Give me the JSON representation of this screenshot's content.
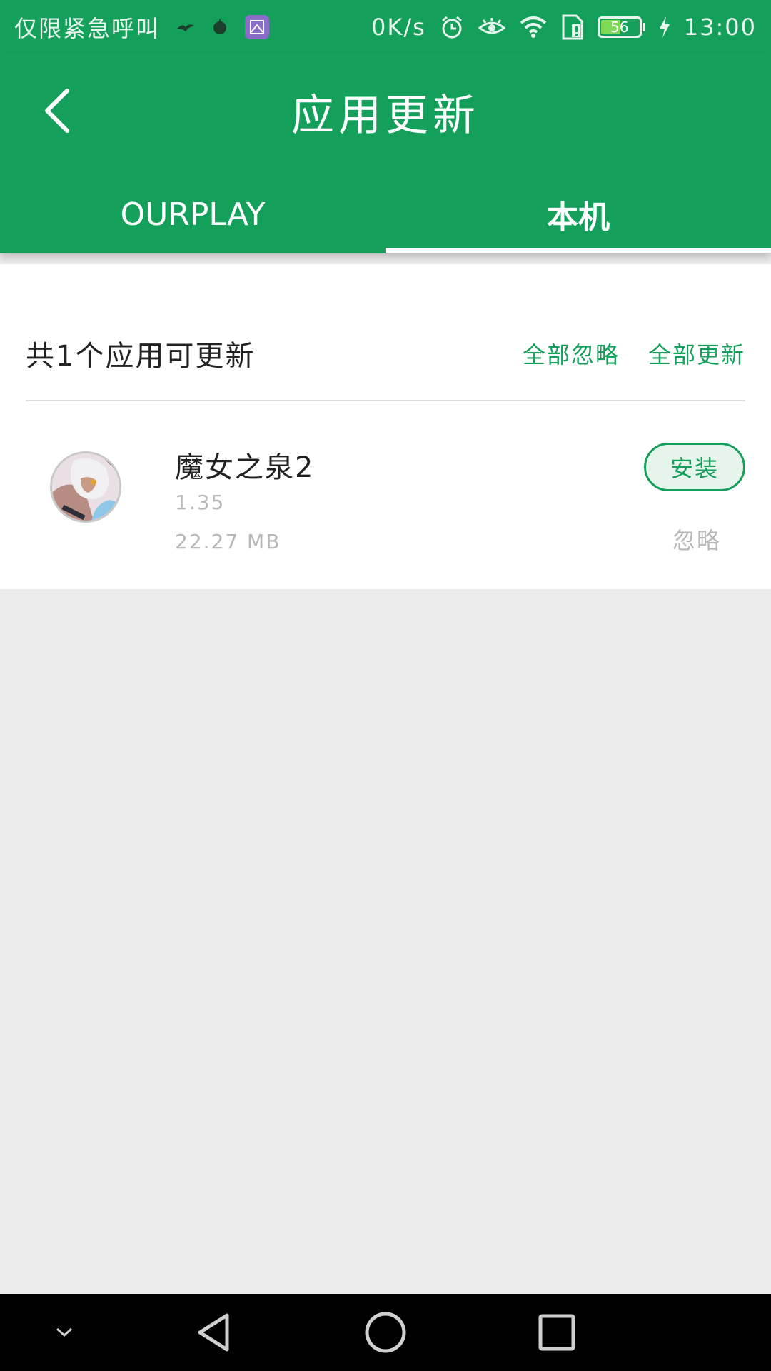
{
  "status_bar": {
    "carrier_text": "仅限紧急呼叫",
    "net_speed": "0K/s",
    "battery_level": "56",
    "battery_fraction": 0.56,
    "time": "13:00"
  },
  "header": {
    "title": "应用更新",
    "tabs": [
      {
        "label": "OURPLAY",
        "active": false
      },
      {
        "label": "本机",
        "active": true
      }
    ]
  },
  "summary": {
    "text": "共1个应用可更新",
    "ignore_all_label": "全部忽略",
    "update_all_label": "全部更新"
  },
  "apps": [
    {
      "name": "魔女之泉2",
      "version": "1.35",
      "size": "22.27 MB",
      "install_label": "安装",
      "ignore_label": "忽略",
      "icon": "app-avatar-icon"
    }
  ],
  "colors": {
    "brand": "#14a05b",
    "background": "#ebebeb",
    "muted_text": "#b7b7b7"
  }
}
